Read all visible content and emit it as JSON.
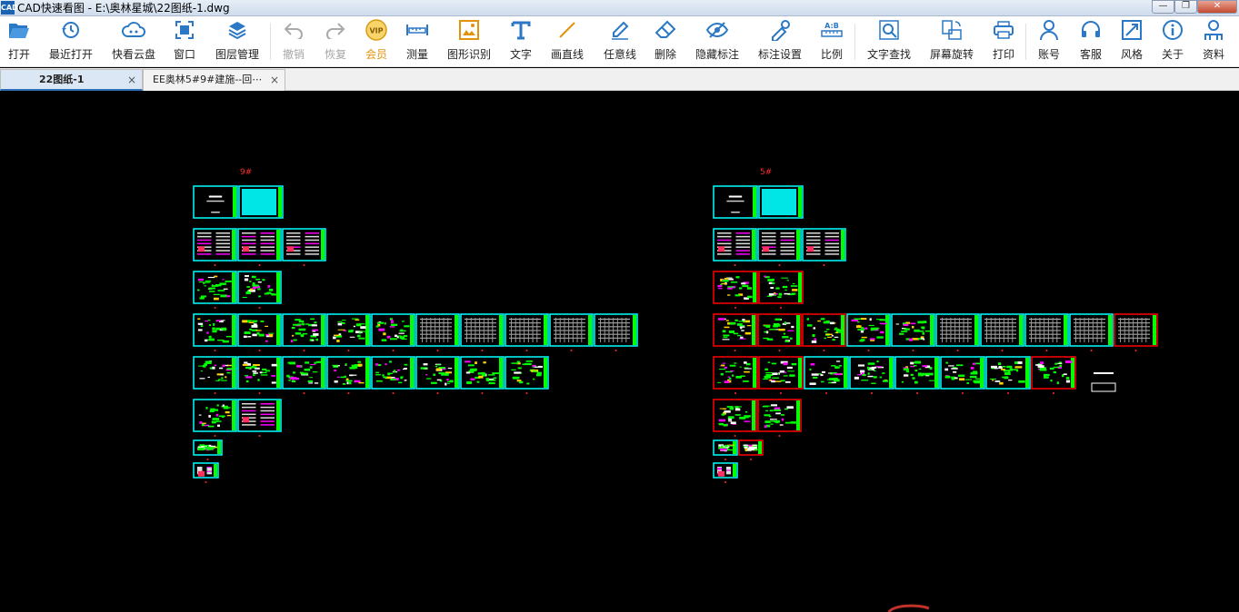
{
  "window": {
    "app_icon": "CAD",
    "title": "CAD快速看图 - E:\\奥林星城\\22图纸-1.dwg",
    "controls": {
      "minimize": "—",
      "restore": "❐",
      "close": "✕"
    }
  },
  "toolbar": {
    "items": [
      {
        "id": "open",
        "label": "打开",
        "icon": "folder-open-icon"
      },
      {
        "id": "recent",
        "label": "最近打开",
        "icon": "recent-clock-icon"
      },
      {
        "id": "cloud",
        "label": "快看云盘",
        "icon": "cloud-icon"
      },
      {
        "id": "window",
        "label": "窗口",
        "icon": "window-icon"
      },
      {
        "id": "layers",
        "label": "图层管理",
        "icon": "layers-icon"
      },
      {
        "id": "undo",
        "label": "撤销",
        "icon": "undo-icon"
      },
      {
        "id": "redo",
        "label": "恢复",
        "icon": "redo-icon"
      },
      {
        "id": "vip",
        "label": "会员",
        "icon": "vip-badge-icon",
        "badge": "VIP"
      },
      {
        "id": "measure",
        "label": "测量",
        "icon": "ruler-icon"
      },
      {
        "id": "shape",
        "label": "图形识别",
        "icon": "shape-recognition-icon"
      },
      {
        "id": "text",
        "label": "文字",
        "icon": "text-t-icon"
      },
      {
        "id": "line",
        "label": "画直线",
        "icon": "line-icon"
      },
      {
        "id": "freeline",
        "label": "任意线",
        "icon": "pen-icon"
      },
      {
        "id": "delete",
        "label": "删除",
        "icon": "eraser-icon"
      },
      {
        "id": "hide",
        "label": "隐藏标注",
        "icon": "eye-slash-icon"
      },
      {
        "id": "annot",
        "label": "标注设置",
        "icon": "annotation-settings-icon"
      },
      {
        "id": "scale",
        "label": "比例",
        "icon": "scale-icon",
        "badge": "A:B"
      },
      {
        "id": "find",
        "label": "文字查找",
        "icon": "text-search-icon"
      },
      {
        "id": "rotate",
        "label": "屏幕旋转",
        "icon": "rotate-screen-icon"
      },
      {
        "id": "print",
        "label": "打印",
        "icon": "printer-icon"
      },
      {
        "id": "account",
        "label": "账号",
        "icon": "user-icon"
      },
      {
        "id": "service",
        "label": "客服",
        "icon": "headset-icon"
      },
      {
        "id": "style",
        "label": "风格",
        "icon": "style-icon"
      },
      {
        "id": "about",
        "label": "关于",
        "icon": "info-icon"
      },
      {
        "id": "docs",
        "label": "资料",
        "icon": "docs-icon"
      }
    ]
  },
  "tabs": [
    {
      "label": "22图纸-1",
      "active": true,
      "close": "×"
    },
    {
      "label": "EE奥林5#9#建施--回⋯",
      "active": false,
      "close": "×"
    }
  ],
  "drawing": {
    "groups": [
      {
        "label": "9#"
      },
      {
        "label": "5#"
      }
    ]
  },
  "colors": {
    "accent": "#2a78c6",
    "vip": "#e3920b",
    "canvas_bg": "#000000",
    "frame_cyan": "#00ffff",
    "frame_red": "#ff0000",
    "frame_green": "#00ff00",
    "label_red": "#ff2a2a",
    "sheet_magenta": "#ff00ff"
  }
}
